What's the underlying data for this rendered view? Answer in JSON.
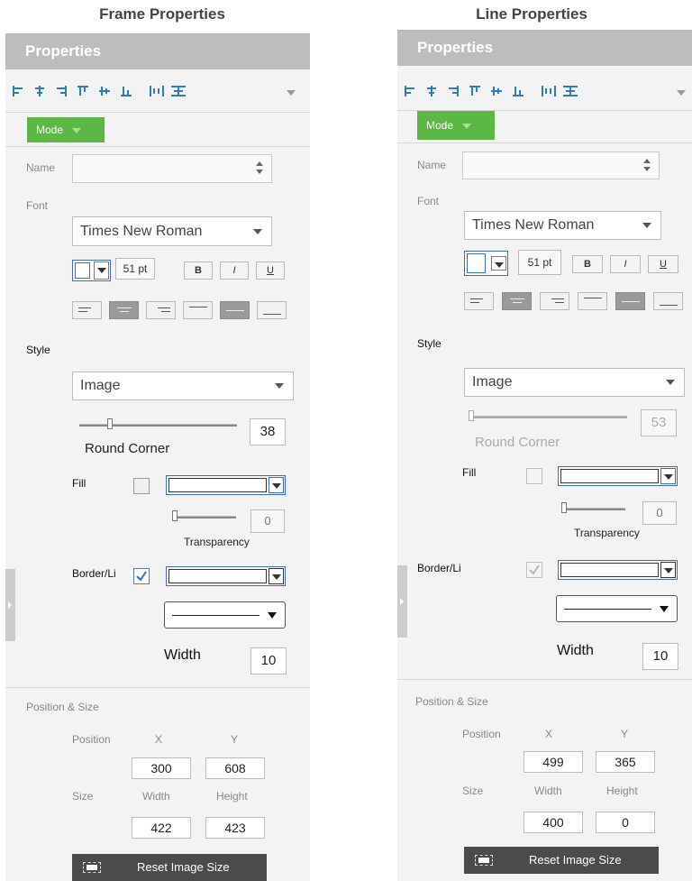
{
  "captions": {
    "left": "Frame Properties",
    "right": "Line Properties"
  },
  "panels": [
    {
      "header": "Properties",
      "mode_label": "Mode",
      "name_label": "Name",
      "name_value": "",
      "font_label": "Font",
      "font_name": "Times New Roman",
      "font_size": "51 pt",
      "bold": "B",
      "italic": "I",
      "underline": "U",
      "style_label": "Style",
      "style_value": "Image",
      "round_corner_value": "38",
      "round_corner_label": "Round Corner",
      "fill_label": "Fill",
      "fill_checked": false,
      "transparency_value": "0",
      "transparency_label": "Transparency",
      "border_label": "Border/Li",
      "border_checked": true,
      "width_label": "Width",
      "width_value": "10",
      "pos_size_label": "Position & Size",
      "position_label": "Position",
      "x_label": "X",
      "y_label": "Y",
      "x_value": "300",
      "y_value": "608",
      "size_label": "Size",
      "width_col_label": "Width",
      "height_col_label": "Height",
      "size_width_value": "422",
      "size_height_value": "423",
      "reset_label": "Reset Image Size"
    },
    {
      "header": "Properties",
      "mode_label": "Mode",
      "name_label": "Name",
      "name_value": "",
      "font_label": "Font",
      "font_name": "Times New Roman",
      "font_size": "51 pt",
      "bold": "B",
      "italic": "I",
      "underline": "U",
      "style_label": "Style",
      "style_value": "Image",
      "round_corner_value": "53",
      "round_corner_label": "Round Corner",
      "fill_label": "Fill",
      "fill_checked": false,
      "transparency_value": "0",
      "transparency_label": "Transparency",
      "border_label": "Border/Li",
      "border_checked": true,
      "width_label": "Width",
      "width_value": "10",
      "pos_size_label": "Position & Size",
      "position_label": "Position",
      "x_label": "X",
      "y_label": "Y",
      "x_value": "499",
      "y_value": "365",
      "size_label": "Size",
      "width_col_label": "Width",
      "height_col_label": "Height",
      "size_width_value": "400",
      "size_height_value": "0",
      "reset_label": "Reset Image Size"
    }
  ],
  "toolbar_icons": [
    "align-left-icon",
    "align-center-h-icon",
    "align-right-icon",
    "align-top-icon",
    "align-middle-v-icon",
    "align-bottom-icon",
    "distribute-h-icon",
    "distribute-v-icon"
  ],
  "colors": {
    "header_bg": "#bdbdbd",
    "mode_green": "#5cb845",
    "panel_bg": "#f3f3f3",
    "reset_bg": "#4b4b4b",
    "check_blue": "#3a6fc0"
  }
}
